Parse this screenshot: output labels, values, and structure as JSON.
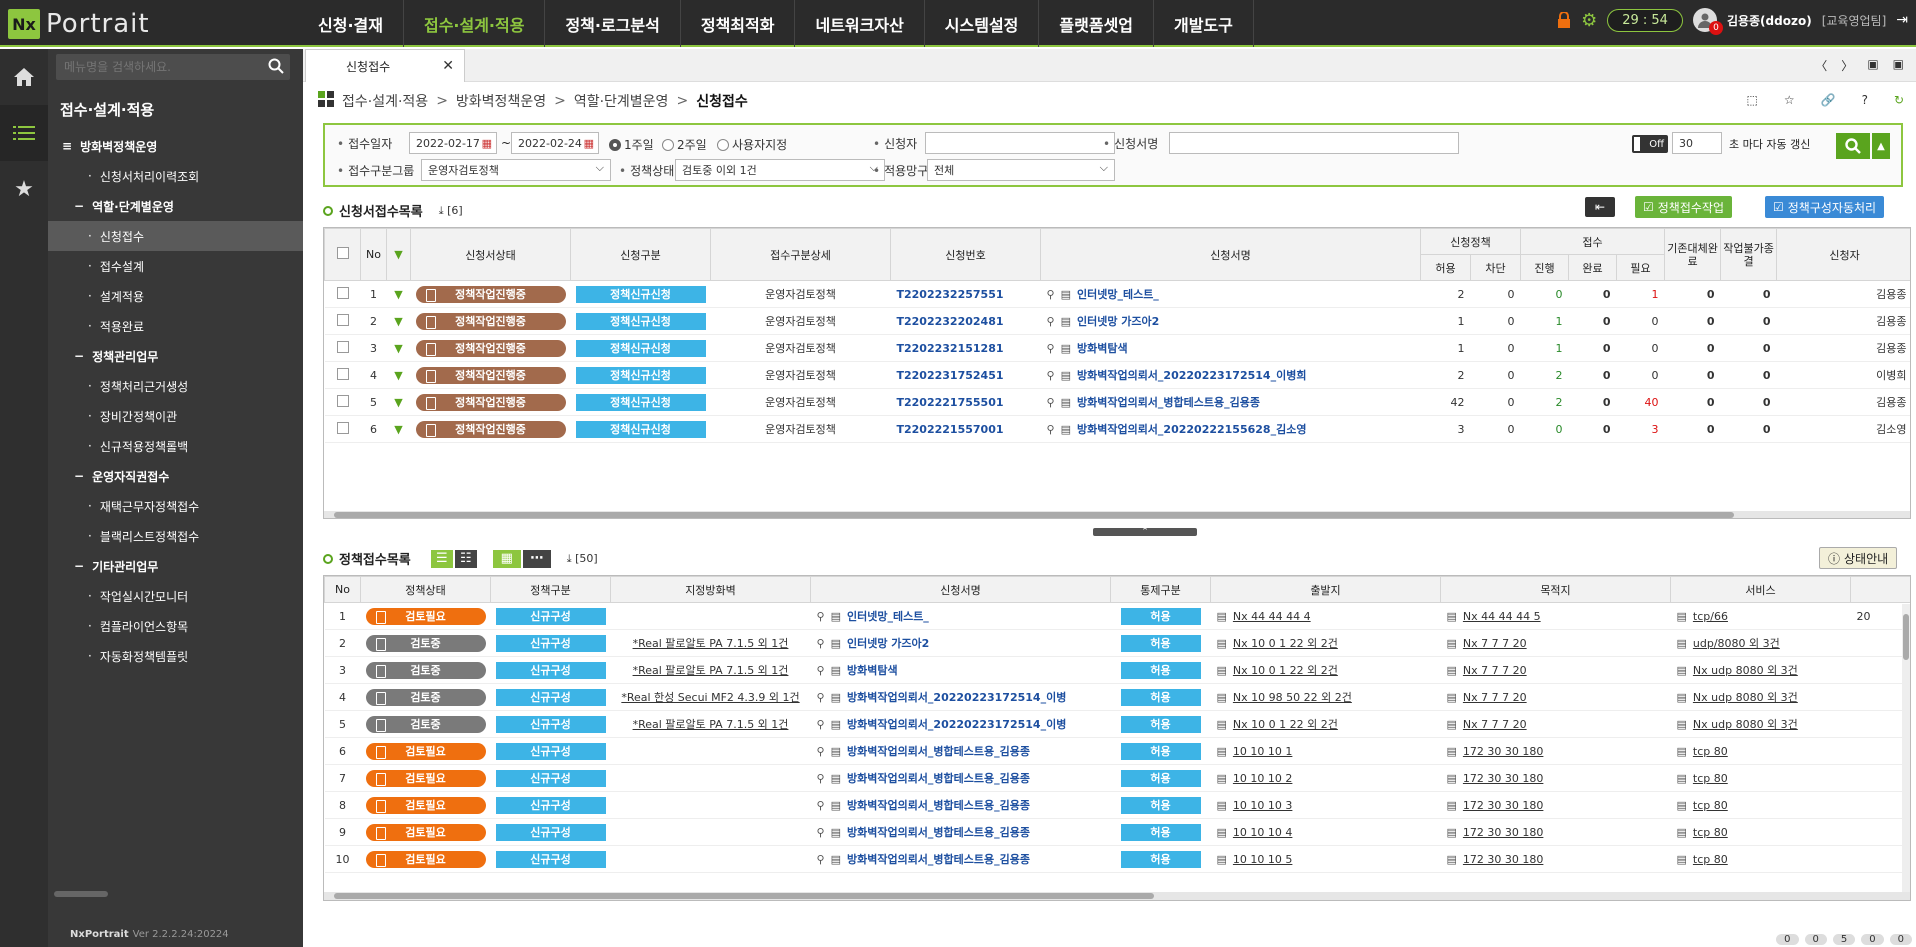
{
  "app": {
    "logo_nx": "Nx",
    "logo_text": "Portrait",
    "version_label": "NxPortrait",
    "version": "Ver 2.2.2.24:20224"
  },
  "nav": [
    "신청·결재",
    "접수·설계·적용",
    "정책·로그분석",
    "정책최적화",
    "네트워크자산",
    "시스템설정",
    "플랫폼셋업",
    "개발도구"
  ],
  "top": {
    "timer": "29 : 54",
    "user": "김용종(ddozo)",
    "dept": "[교육영업팀]",
    "badge": "0"
  },
  "sidebar": {
    "search_placeholder": "메뉴명을 검색하세요.",
    "title": "접수·설계·적용",
    "items": [
      {
        "label": "방화벽정책운영",
        "level": "l0"
      },
      {
        "label": "신청서처리이력조회",
        "level": "l2"
      },
      {
        "label": "역할·단계별운영",
        "level": "l1"
      },
      {
        "label": "신청접수",
        "level": "l2",
        "sel": true
      },
      {
        "label": "접수설계",
        "level": "l2"
      },
      {
        "label": "설계적용",
        "level": "l2"
      },
      {
        "label": "적용완료",
        "level": "l2"
      },
      {
        "label": "정책관리업무",
        "level": "l1"
      },
      {
        "label": "정책처리근거생성",
        "level": "l2"
      },
      {
        "label": "장비간정책이관",
        "level": "l2"
      },
      {
        "label": "신규적용정책롤백",
        "level": "l2"
      },
      {
        "label": "운영자직권접수",
        "level": "l1"
      },
      {
        "label": "재택근무자정책접수",
        "level": "l2"
      },
      {
        "label": "블랙리스트정책접수",
        "level": "l2"
      },
      {
        "label": "기타관리업무",
        "level": "l1"
      },
      {
        "label": "작업실시간모니터",
        "level": "l2"
      },
      {
        "label": "컴플라이언스항목",
        "level": "l2"
      },
      {
        "label": "자동화정책템플릿",
        "level": "l2"
      }
    ]
  },
  "tab": {
    "label": "신청접수"
  },
  "breadcrumb": [
    "접수·설계·적용",
    "방화벽정책운영",
    "역할·단계별운영",
    "신청접수"
  ],
  "filter": {
    "lbl_date": "접수일자",
    "date_from": "2022-02-17",
    "date_to": "2022-02-24",
    "r1": "1주일",
    "r2": "2주일",
    "r3": "사용자지정",
    "lbl_applicant": "신청자",
    "applicant": "",
    "lbl_docname": "신청서명",
    "docname": "",
    "off": "Off",
    "interval": "30",
    "interval_suffix": "초 마다 자동 갱신",
    "lbl_group": "접수구분그룹",
    "group": "운영자검토정책",
    "lbl_state": "정책상태",
    "state": "검토중 이외 1건",
    "lbl_net": "적용망구간",
    "net": "전체"
  },
  "upper": {
    "title": "신청서접수목록",
    "count": "[6]",
    "btn_work": "정책접수작업",
    "btn_auto": "정책구성자동처리",
    "headers": {
      "no": "No",
      "status": "신청서상태",
      "type": "신청구분",
      "detail": "접수구분상세",
      "num": "신청번호",
      "name": "신청서명",
      "policy": "신청정책",
      "allow": "허용",
      "deny": "차단",
      "recv": "접수",
      "prog": "진행",
      "done": "완료",
      "need": "필요",
      "alt": "기존대체완료",
      "fin": "작업불가종결",
      "req": "신청자"
    },
    "rows": [
      {
        "no": "1",
        "status": "정책작업진행중",
        "type": "정책신규신청",
        "detail": "운영자검토정책",
        "num": "T2202232257551",
        "name": "인터넷망_테스트_",
        "allow": "2",
        "deny": "0",
        "prog": "0",
        "done": "0",
        "need": "1",
        "alt": "0",
        "fin": "0",
        "req": "김용종"
      },
      {
        "no": "2",
        "status": "정책작업진행중",
        "type": "정책신규신청",
        "detail": "운영자검토정책",
        "num": "T2202232202481",
        "name": "인터넷망 가즈아2",
        "allow": "1",
        "deny": "0",
        "prog": "1",
        "done": "0",
        "need": "0",
        "alt": "0",
        "fin": "0",
        "req": "김용종"
      },
      {
        "no": "3",
        "status": "정책작업진행중",
        "type": "정책신규신청",
        "detail": "운영자검토정책",
        "num": "T2202232151281",
        "name": "방화벽탐색",
        "allow": "1",
        "deny": "0",
        "prog": "1",
        "done": "0",
        "need": "0",
        "alt": "0",
        "fin": "0",
        "req": "김용종"
      },
      {
        "no": "4",
        "status": "정책작업진행중",
        "type": "정책신규신청",
        "detail": "운영자검토정책",
        "num": "T2202231752451",
        "name": "방화벽작업의뢰서_20220223172514_이병희",
        "allow": "2",
        "deny": "0",
        "prog": "2",
        "done": "0",
        "need": "0",
        "alt": "0",
        "fin": "0",
        "req": "이병희"
      },
      {
        "no": "5",
        "status": "정책작업진행중",
        "type": "정책신규신청",
        "detail": "운영자검토정책",
        "num": "T2202221755501",
        "name": "방화벽작업의뢰서_병합테스트용_김용종",
        "allow": "42",
        "deny": "0",
        "prog": "2",
        "done": "0",
        "need": "40",
        "alt": "0",
        "fin": "0",
        "req": "김용종"
      },
      {
        "no": "6",
        "status": "정책작업진행중",
        "type": "정책신규신청",
        "detail": "운영자검토정책",
        "num": "T2202221557001",
        "name": "방화벽작업의뢰서_20220222155628_김소영",
        "allow": "3",
        "deny": "0",
        "prog": "0",
        "done": "0",
        "need": "3",
        "alt": "0",
        "fin": "0",
        "req": "김소영"
      }
    ]
  },
  "lower": {
    "title": "정책접수목록",
    "count": "[50]",
    "legend": "상태안내",
    "headers": {
      "no": "No",
      "state": "정책상태",
      "type": "정책구분",
      "fw": "지정방화벽",
      "name": "신청서명",
      "ctrl": "통제구분",
      "src": "출발지",
      "dst": "목적지",
      "svc": "서비스"
    },
    "rows": [
      {
        "no": "1",
        "state": "검토필요",
        "c": "orange",
        "type": "신규구성",
        "fw": "",
        "name": "인터넷망_테스트_",
        "ctrl": "허용",
        "src": "Nx 44 44 44 4",
        "dst": "Nx 44 44 44 5",
        "svc": "tcp/66",
        "x": "20"
      },
      {
        "no": "2",
        "state": "검토중",
        "c": "gray",
        "type": "신규구성",
        "fw": "*Real 팔로알토 PA 7.1.5 외 1건",
        "name": "인터넷망 가즈아2",
        "ctrl": "허용",
        "src": "Nx 10 0 1 22 외 2건",
        "dst": "Nx 7 7 7 20",
        "svc": "udp/8080 외 3건",
        "x": ""
      },
      {
        "no": "3",
        "state": "검토중",
        "c": "gray",
        "type": "신규구성",
        "fw": "*Real 팔로알토 PA 7.1.5 외 1건",
        "name": "방화벽탐색",
        "ctrl": "허용",
        "src": "Nx 10 0 1 22 외 2건",
        "dst": "Nx 7 7 7 20",
        "svc": "Nx udp 8080 외 3건",
        "x": ""
      },
      {
        "no": "4",
        "state": "검토중",
        "c": "gray",
        "type": "신규구성",
        "fw": "*Real 한성 Secui MF2 4.3.9 외 1건",
        "name": "방화벽작업의뢰서_20220223172514_이병",
        "ctrl": "허용",
        "src": "Nx 10 98 50 22 외 2건",
        "dst": "Nx 7 7 7 20",
        "svc": "Nx udp 8080 외 3건",
        "x": ""
      },
      {
        "no": "5",
        "state": "검토중",
        "c": "gray",
        "type": "신규구성",
        "fw": "*Real 팔로알토 PA 7.1.5 외 1건",
        "name": "방화벽작업의뢰서_20220223172514_이병",
        "ctrl": "허용",
        "src": "Nx 10 0 1 22 외 2건",
        "dst": "Nx 7 7 7 20",
        "svc": "Nx udp 8080 외 3건",
        "x": ""
      },
      {
        "no": "6",
        "state": "검토필요",
        "c": "orange",
        "type": "신규구성",
        "fw": "",
        "name": "방화벽작업의뢰서_병합테스트용_김용종",
        "ctrl": "허용",
        "src": "10 10 10 1",
        "dst": "172 30 30 180",
        "svc": "tcp 80",
        "x": ""
      },
      {
        "no": "7",
        "state": "검토필요",
        "c": "orange",
        "type": "신규구성",
        "fw": "",
        "name": "방화벽작업의뢰서_병합테스트용_김용종",
        "ctrl": "허용",
        "src": "10 10 10 2",
        "dst": "172 30 30 180",
        "svc": "tcp 80",
        "x": ""
      },
      {
        "no": "8",
        "state": "검토필요",
        "c": "orange",
        "type": "신규구성",
        "fw": "",
        "name": "방화벽작업의뢰서_병합테스트용_김용종",
        "ctrl": "허용",
        "src": "10 10 10 3",
        "dst": "172 30 30 180",
        "svc": "tcp 80",
        "x": ""
      },
      {
        "no": "9",
        "state": "검토필요",
        "c": "orange",
        "type": "신규구성",
        "fw": "",
        "name": "방화벽작업의뢰서_병합테스트용_김용종",
        "ctrl": "허용",
        "src": "10 10 10 4",
        "dst": "172 30 30 180",
        "svc": "tcp 80",
        "x": ""
      },
      {
        "no": "10",
        "state": "검토필요",
        "c": "orange",
        "type": "신규구성",
        "fw": "",
        "name": "방화벽작업의뢰서_병합테스트용_김용종",
        "ctrl": "허용",
        "src": "10 10 10 5",
        "dst": "172 30 30 180",
        "svc": "tcp 80",
        "x": ""
      }
    ]
  },
  "status_counts": [
    "0",
    "0",
    "5",
    "0",
    "0"
  ]
}
